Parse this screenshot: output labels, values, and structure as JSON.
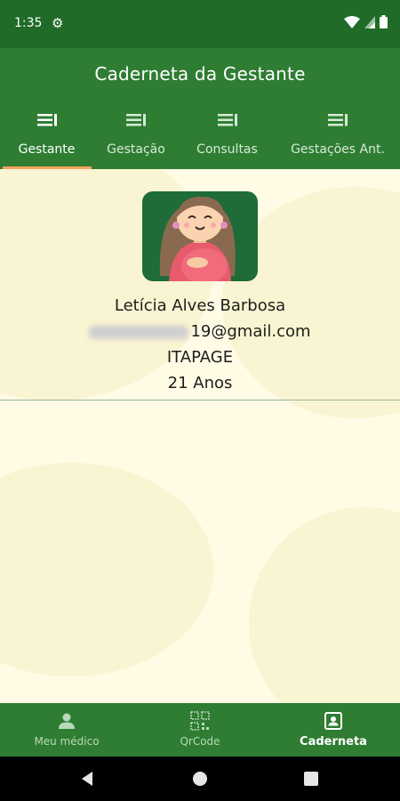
{
  "status_bar": {
    "time": "1:35"
  },
  "app_bar": {
    "title": "Caderneta da Gestante"
  },
  "tabs": [
    {
      "label": "Gestante",
      "active": true
    },
    {
      "label": "Gestação",
      "active": false
    },
    {
      "label": "Consultas",
      "active": false
    },
    {
      "label": "Gestações Ant.",
      "active": false
    }
  ],
  "profile": {
    "name": "Letícia Alves Barbosa",
    "email_visible": "19@gmail.com",
    "city": "ITAPAGE",
    "age": "21 Anos"
  },
  "bottom_nav": [
    {
      "label": "Meu médico",
      "icon": "person-icon",
      "active": false
    },
    {
      "label": "QrCode",
      "icon": "qrcode-icon",
      "active": false
    },
    {
      "label": "Caderneta",
      "icon": "contact-card-icon",
      "active": true
    }
  ],
  "colors": {
    "primary": "#2e7d32",
    "status_bar": "#1f6b27",
    "tab_indicator": "#f3a25c",
    "background": "#fffbe5"
  }
}
